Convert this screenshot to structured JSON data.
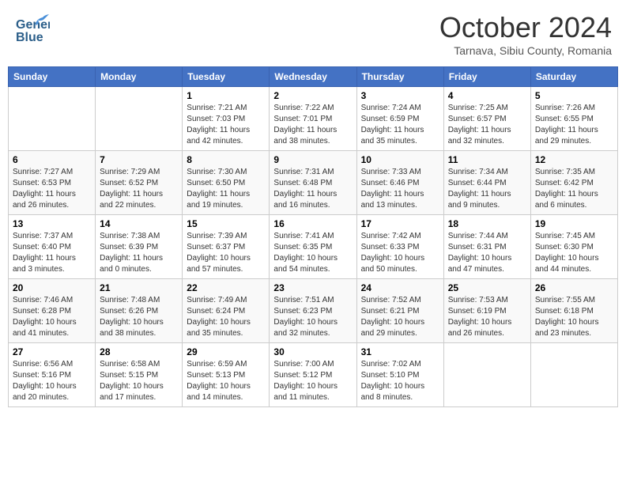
{
  "header": {
    "logo_line1": "General",
    "logo_line2": "Blue",
    "month": "October 2024",
    "location": "Tarnava, Sibiu County, Romania"
  },
  "days_of_week": [
    "Sunday",
    "Monday",
    "Tuesday",
    "Wednesday",
    "Thursday",
    "Friday",
    "Saturday"
  ],
  "weeks": [
    [
      {
        "day": "",
        "info": ""
      },
      {
        "day": "",
        "info": ""
      },
      {
        "day": "1",
        "info": "Sunrise: 7:21 AM\nSunset: 7:03 PM\nDaylight: 11 hours and 42 minutes."
      },
      {
        "day": "2",
        "info": "Sunrise: 7:22 AM\nSunset: 7:01 PM\nDaylight: 11 hours and 38 minutes."
      },
      {
        "day": "3",
        "info": "Sunrise: 7:24 AM\nSunset: 6:59 PM\nDaylight: 11 hours and 35 minutes."
      },
      {
        "day": "4",
        "info": "Sunrise: 7:25 AM\nSunset: 6:57 PM\nDaylight: 11 hours and 32 minutes."
      },
      {
        "day": "5",
        "info": "Sunrise: 7:26 AM\nSunset: 6:55 PM\nDaylight: 11 hours and 29 minutes."
      }
    ],
    [
      {
        "day": "6",
        "info": "Sunrise: 7:27 AM\nSunset: 6:53 PM\nDaylight: 11 hours and 26 minutes."
      },
      {
        "day": "7",
        "info": "Sunrise: 7:29 AM\nSunset: 6:52 PM\nDaylight: 11 hours and 22 minutes."
      },
      {
        "day": "8",
        "info": "Sunrise: 7:30 AM\nSunset: 6:50 PM\nDaylight: 11 hours and 19 minutes."
      },
      {
        "day": "9",
        "info": "Sunrise: 7:31 AM\nSunset: 6:48 PM\nDaylight: 11 hours and 16 minutes."
      },
      {
        "day": "10",
        "info": "Sunrise: 7:33 AM\nSunset: 6:46 PM\nDaylight: 11 hours and 13 minutes."
      },
      {
        "day": "11",
        "info": "Sunrise: 7:34 AM\nSunset: 6:44 PM\nDaylight: 11 hours and 9 minutes."
      },
      {
        "day": "12",
        "info": "Sunrise: 7:35 AM\nSunset: 6:42 PM\nDaylight: 11 hours and 6 minutes."
      }
    ],
    [
      {
        "day": "13",
        "info": "Sunrise: 7:37 AM\nSunset: 6:40 PM\nDaylight: 11 hours and 3 minutes."
      },
      {
        "day": "14",
        "info": "Sunrise: 7:38 AM\nSunset: 6:39 PM\nDaylight: 11 hours and 0 minutes."
      },
      {
        "day": "15",
        "info": "Sunrise: 7:39 AM\nSunset: 6:37 PM\nDaylight: 10 hours and 57 minutes."
      },
      {
        "day": "16",
        "info": "Sunrise: 7:41 AM\nSunset: 6:35 PM\nDaylight: 10 hours and 54 minutes."
      },
      {
        "day": "17",
        "info": "Sunrise: 7:42 AM\nSunset: 6:33 PM\nDaylight: 10 hours and 50 minutes."
      },
      {
        "day": "18",
        "info": "Sunrise: 7:44 AM\nSunset: 6:31 PM\nDaylight: 10 hours and 47 minutes."
      },
      {
        "day": "19",
        "info": "Sunrise: 7:45 AM\nSunset: 6:30 PM\nDaylight: 10 hours and 44 minutes."
      }
    ],
    [
      {
        "day": "20",
        "info": "Sunrise: 7:46 AM\nSunset: 6:28 PM\nDaylight: 10 hours and 41 minutes."
      },
      {
        "day": "21",
        "info": "Sunrise: 7:48 AM\nSunset: 6:26 PM\nDaylight: 10 hours and 38 minutes."
      },
      {
        "day": "22",
        "info": "Sunrise: 7:49 AM\nSunset: 6:24 PM\nDaylight: 10 hours and 35 minutes."
      },
      {
        "day": "23",
        "info": "Sunrise: 7:51 AM\nSunset: 6:23 PM\nDaylight: 10 hours and 32 minutes."
      },
      {
        "day": "24",
        "info": "Sunrise: 7:52 AM\nSunset: 6:21 PM\nDaylight: 10 hours and 29 minutes."
      },
      {
        "day": "25",
        "info": "Sunrise: 7:53 AM\nSunset: 6:19 PM\nDaylight: 10 hours and 26 minutes."
      },
      {
        "day": "26",
        "info": "Sunrise: 7:55 AM\nSunset: 6:18 PM\nDaylight: 10 hours and 23 minutes."
      }
    ],
    [
      {
        "day": "27",
        "info": "Sunrise: 6:56 AM\nSunset: 5:16 PM\nDaylight: 10 hours and 20 minutes."
      },
      {
        "day": "28",
        "info": "Sunrise: 6:58 AM\nSunset: 5:15 PM\nDaylight: 10 hours and 17 minutes."
      },
      {
        "day": "29",
        "info": "Sunrise: 6:59 AM\nSunset: 5:13 PM\nDaylight: 10 hours and 14 minutes."
      },
      {
        "day": "30",
        "info": "Sunrise: 7:00 AM\nSunset: 5:12 PM\nDaylight: 10 hours and 11 minutes."
      },
      {
        "day": "31",
        "info": "Sunrise: 7:02 AM\nSunset: 5:10 PM\nDaylight: 10 hours and 8 minutes."
      },
      {
        "day": "",
        "info": ""
      },
      {
        "day": "",
        "info": ""
      }
    ]
  ]
}
